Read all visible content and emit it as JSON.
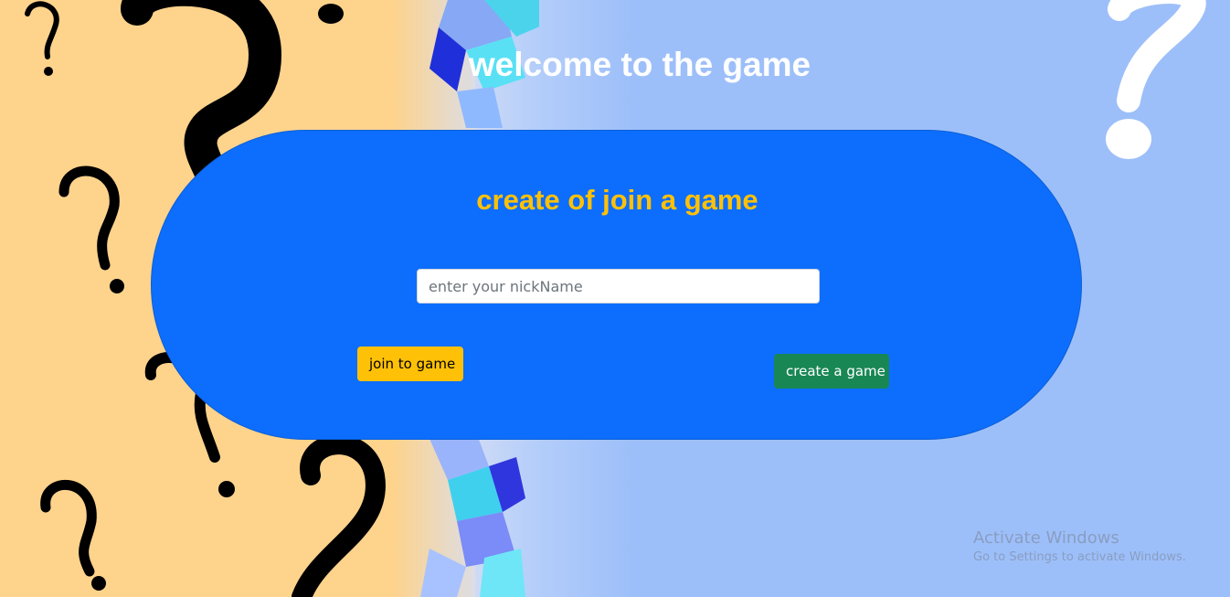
{
  "page": {
    "title": "welcome to the game",
    "title_color": "#ffffff"
  },
  "panel": {
    "heading": "create of join a game",
    "heading_color": "#ffc107",
    "background": "#0d6efd",
    "nickname_input": {
      "value": "",
      "placeholder": "enter your nickName"
    },
    "join_button_label": "join to game",
    "join_button_color": "#ffc107",
    "create_button_label": "create a game",
    "create_button_color": "#198754"
  },
  "background": {
    "left_color": "#fed38c",
    "right_color": "#9dbff9",
    "decorations": [
      "question-mark-icon",
      "cube-icon"
    ]
  },
  "watermark": {
    "title": "Activate Windows",
    "subtitle": "Go to Settings to activate Windows."
  }
}
